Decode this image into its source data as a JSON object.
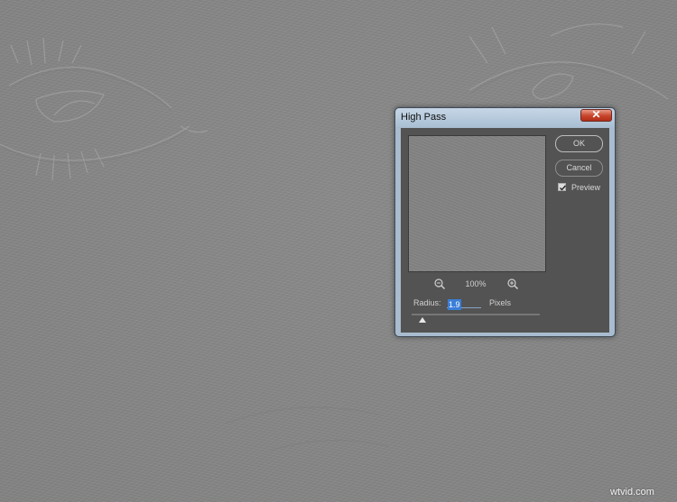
{
  "dialog": {
    "title": "High Pass",
    "close_glyph": "✕",
    "zoom_level": "100%",
    "radius_label": "Radius:",
    "radius_value": "1.9",
    "pixels_label": "Pixels",
    "ok_label": "OK",
    "cancel_label": "Cancel",
    "preview_label": "Preview",
    "preview_checked": true,
    "zoom_out_icon": "zoom-out-magnifier",
    "zoom_in_icon": "zoom-in-magnifier"
  },
  "watermark": "wtvid.com",
  "colors": {
    "canvas_gray": "#888a88",
    "dialog_body": "#535353",
    "titlebar": "#aabfd3",
    "close_red": "#c7432a",
    "selection_blue": "#3a7ed8"
  }
}
